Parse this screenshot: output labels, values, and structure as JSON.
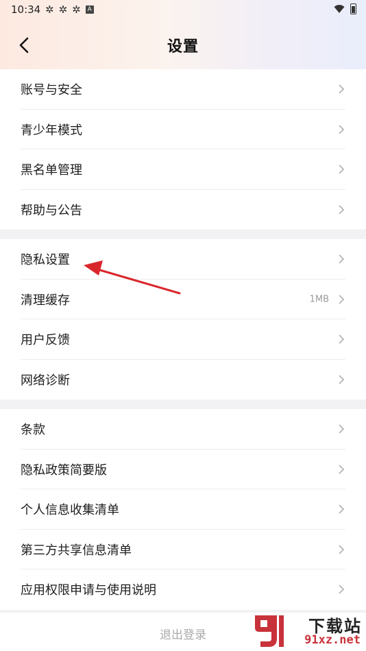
{
  "status": {
    "time": "10:34",
    "badge": "A"
  },
  "header": {
    "title": "设置"
  },
  "groups": [
    {
      "items": [
        {
          "label": "账号与安全"
        },
        {
          "label": "青少年模式"
        },
        {
          "label": "黑名单管理"
        },
        {
          "label": "帮助与公告"
        }
      ]
    },
    {
      "items": [
        {
          "label": "隐私设置"
        },
        {
          "label": "清理缓存",
          "value": "1MB"
        },
        {
          "label": "用户反馈"
        },
        {
          "label": "网络诊断"
        }
      ]
    },
    {
      "items": [
        {
          "label": "条款"
        },
        {
          "label": "隐私政策简要版"
        },
        {
          "label": "个人信息收集清单"
        },
        {
          "label": "第三方共享信息清单"
        },
        {
          "label": "应用权限申请与使用说明"
        }
      ]
    }
  ],
  "logout": {
    "label": "退出登录"
  },
  "watermark": {
    "cn": "下载站",
    "en": "91xz.net"
  },
  "colors": {
    "annotation_arrow": "#d9262b",
    "watermark_red": "#c8323a"
  }
}
